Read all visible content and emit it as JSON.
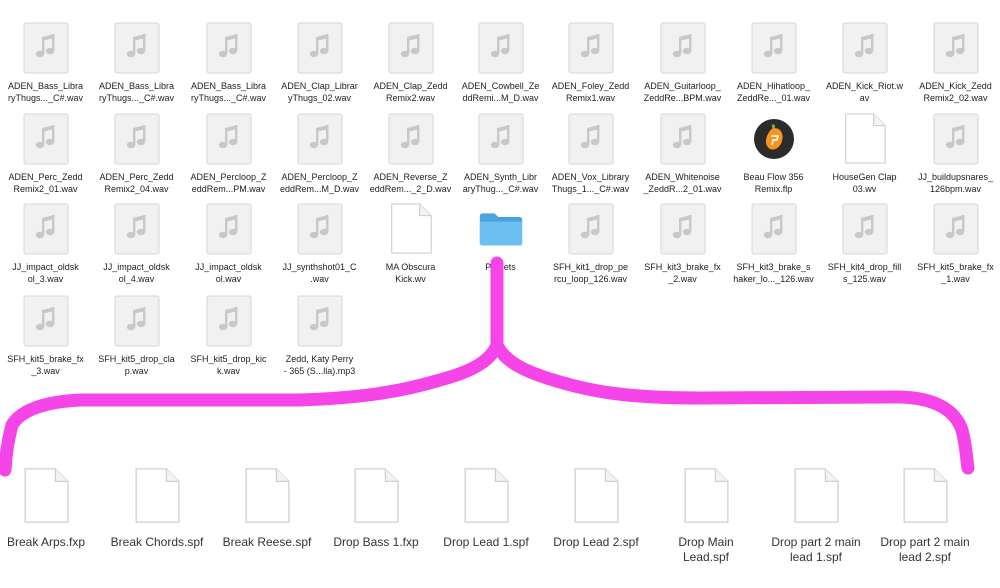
{
  "grid_files": [
    {
      "name": "ADEN_Bass_Libra\nryThugs..._C#.wav",
      "icon": "audio-file-icon"
    },
    {
      "name": "ADEN_Bass_Libra\nryThugs..._C#.wav",
      "icon": "audio-file-icon"
    },
    {
      "name": "ADEN_Bass_Libra\nryThugs..._C#.wav",
      "icon": "audio-file-icon"
    },
    {
      "name": "ADEN_Clap_Librar\nyThugs_02.wav",
      "icon": "audio-file-icon"
    },
    {
      "name": "ADEN_Clap_Zedd\nRemix2.wav",
      "icon": "audio-file-icon"
    },
    {
      "name": "ADEN_Cowbell_Ze\nddRemi...M_D.wav",
      "icon": "audio-file-icon"
    },
    {
      "name": "ADEN_Foley_Zedd\nRemix1.wav",
      "icon": "audio-file-icon"
    },
    {
      "name": "ADEN_Guitarloop_\nZeddRe...BPM.wav",
      "icon": "audio-file-icon"
    },
    {
      "name": "ADEN_Hihatloop_\nZeddRe..._01.wav",
      "icon": "audio-file-icon"
    },
    {
      "name": "ADEN_Kick_Riot.w\nav",
      "icon": "audio-file-icon"
    },
    {
      "name": "ADEN_Kick_Zedd\nRemix2_02.wav",
      "icon": "audio-file-icon"
    },
    {
      "name": "ADEN_Perc_Zedd\nRemix2_01.wav",
      "icon": "audio-file-icon"
    },
    {
      "name": "ADEN_Perc_Zedd\nRemix2_04.wav",
      "icon": "audio-file-icon"
    },
    {
      "name": "ADEN_Percloop_Z\neddRem...PM.wav",
      "icon": "audio-file-icon"
    },
    {
      "name": "ADEN_Percloop_Z\neddRem...M_D.wav",
      "icon": "audio-file-icon"
    },
    {
      "name": "ADEN_Reverse_Z\neddRem..._2_D.wav",
      "icon": "audio-file-icon"
    },
    {
      "name": "ADEN_Synth_Libr\naryThug..._C#.wav",
      "icon": "audio-file-icon"
    },
    {
      "name": "ADEN_Vox_Library\nThugs_1..._C#.wav",
      "icon": "audio-file-icon"
    },
    {
      "name": "ADEN_Whitenoise\n_ZeddR...2_01.wav",
      "icon": "audio-file-icon"
    },
    {
      "name": "Beau Flow 356\nRemix.flp",
      "icon": "fl-studio-project-icon"
    },
    {
      "name": "HouseGen Clap\n03.wv",
      "icon": "blank-document-icon"
    },
    {
      "name": "JJ_buildupsnares_\n126bpm.wav",
      "icon": "audio-file-icon"
    },
    {
      "name": "JJ_impact_oldsk\nol_3.wav",
      "icon": "audio-file-icon"
    },
    {
      "name": "JJ_impact_oldsk\nol_4.wav",
      "icon": "audio-file-icon"
    },
    {
      "name": "JJ_impact_oldsk\nol.wav",
      "icon": "audio-file-icon"
    },
    {
      "name": "JJ_synthshot01_C\n.wav",
      "icon": "audio-file-icon"
    },
    {
      "name": "MA Obscura\nKick.wv",
      "icon": "blank-document-icon"
    },
    {
      "name": "Presets",
      "icon": "folder-icon"
    },
    {
      "name": "SFH_kit1_drop_pe\nrcu_loop_126.wav",
      "icon": "audio-file-icon"
    },
    {
      "name": "SFH_kit3_brake_fx\n_2.wav",
      "icon": "audio-file-icon"
    },
    {
      "name": "SFH_kit3_brake_s\nhaker_lo..._126.wav",
      "icon": "audio-file-icon"
    },
    {
      "name": "SFH_kit4_drop_fill\ns_125.wav",
      "icon": "audio-file-icon"
    },
    {
      "name": "SFH_kit5_brake_fx\n_1.wav",
      "icon": "audio-file-icon"
    },
    {
      "name": "SFH_kit5_brake_fx\n_3.wav",
      "icon": "audio-file-icon"
    },
    {
      "name": "SFH_kit5_drop_cla\np.wav",
      "icon": "audio-file-icon"
    },
    {
      "name": "SFH_kit5_drop_kic\nk.wav",
      "icon": "audio-file-icon"
    },
    {
      "name": "Zedd, Katy Perry\n- 365 (S...lla).mp3",
      "icon": "audio-file-icon"
    }
  ],
  "preset_files": [
    {
      "name": "Break Arps.fxp",
      "icon": "blank-document-icon"
    },
    {
      "name": "Break Chords.spf",
      "icon": "blank-document-icon"
    },
    {
      "name": "Break Reese.spf",
      "icon": "blank-document-icon"
    },
    {
      "name": "Drop Bass 1.fxp",
      "icon": "blank-document-icon"
    },
    {
      "name": "Drop Lead 1.spf",
      "icon": "blank-document-icon"
    },
    {
      "name": "Drop Lead 2.spf",
      "icon": "blank-document-icon"
    },
    {
      "name": "Drop Main\nLead.spf",
      "icon": "blank-document-icon"
    },
    {
      "name": "Drop part 2 main\nlead 1.spf",
      "icon": "blank-document-icon"
    },
    {
      "name": "Drop part 2 main\nlead 2.spf",
      "icon": "blank-document-icon"
    }
  ],
  "annotation": {
    "color": "#f545e8",
    "icon": "hand-drawn-brace"
  }
}
